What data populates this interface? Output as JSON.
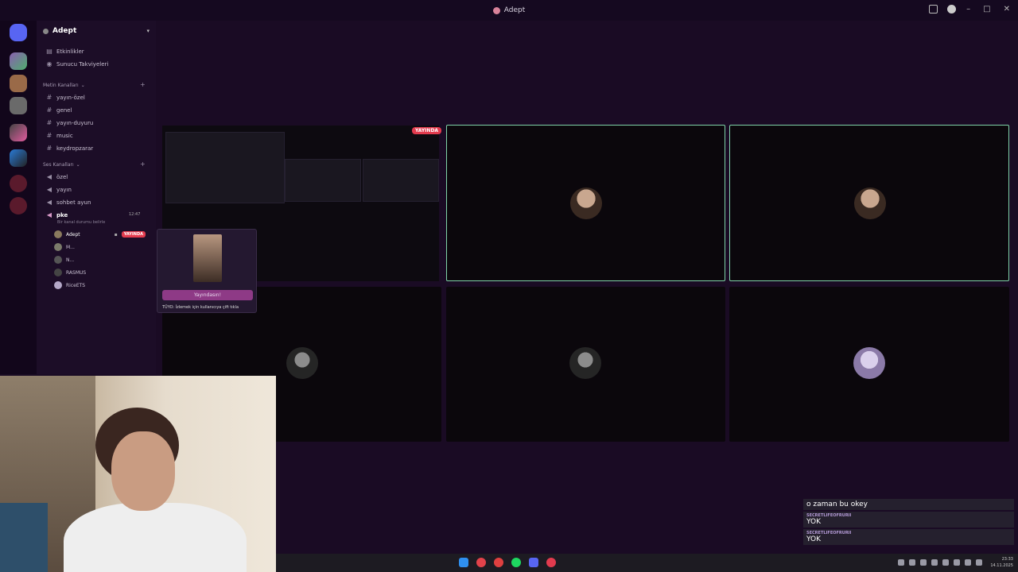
{
  "window": {
    "title": "Adept"
  },
  "server": {
    "name": "Adept"
  },
  "top_items": [
    {
      "icon": "calendar-icon",
      "label": "Etkinlikler"
    },
    {
      "icon": "boost-icon",
      "label": "Sunucu Takviyeleri"
    }
  ],
  "text_category": "Metin Kanalları",
  "text_channels": [
    "yayın-özel",
    "genel",
    "yayın-duyuru",
    "music",
    "keydropzarar"
  ],
  "voice_category": "Ses Kanalları",
  "voice_channels": [
    "özel",
    "yayın",
    "sohbet ayun",
    "pke"
  ],
  "active_channel": {
    "name": "pke",
    "time": "12:47",
    "status": "Bir kanal durumu belirle"
  },
  "members": [
    {
      "name": "Adept",
      "live": "YAYINDA"
    },
    {
      "name": "M..."
    },
    {
      "name": "N..."
    },
    {
      "name": "RASMUS"
    },
    {
      "name": "RiceETS"
    }
  ],
  "stream": {
    "live_badge": "YAYINDA"
  },
  "popup": {
    "watch_label": "Yayındasın!",
    "tip": "TÜYO: İzlemek için kullanıcıya çift tıkla"
  },
  "chat": [
    {
      "user": "",
      "text": "o zaman bu okey"
    },
    {
      "user": "SECRETLIFEOFRURII",
      "text": "YOK"
    },
    {
      "user": "SECRETLIFEOFRURII",
      "text": "YOK"
    }
  ],
  "clock": {
    "time": "23:33",
    "date": "14.11.2025"
  }
}
